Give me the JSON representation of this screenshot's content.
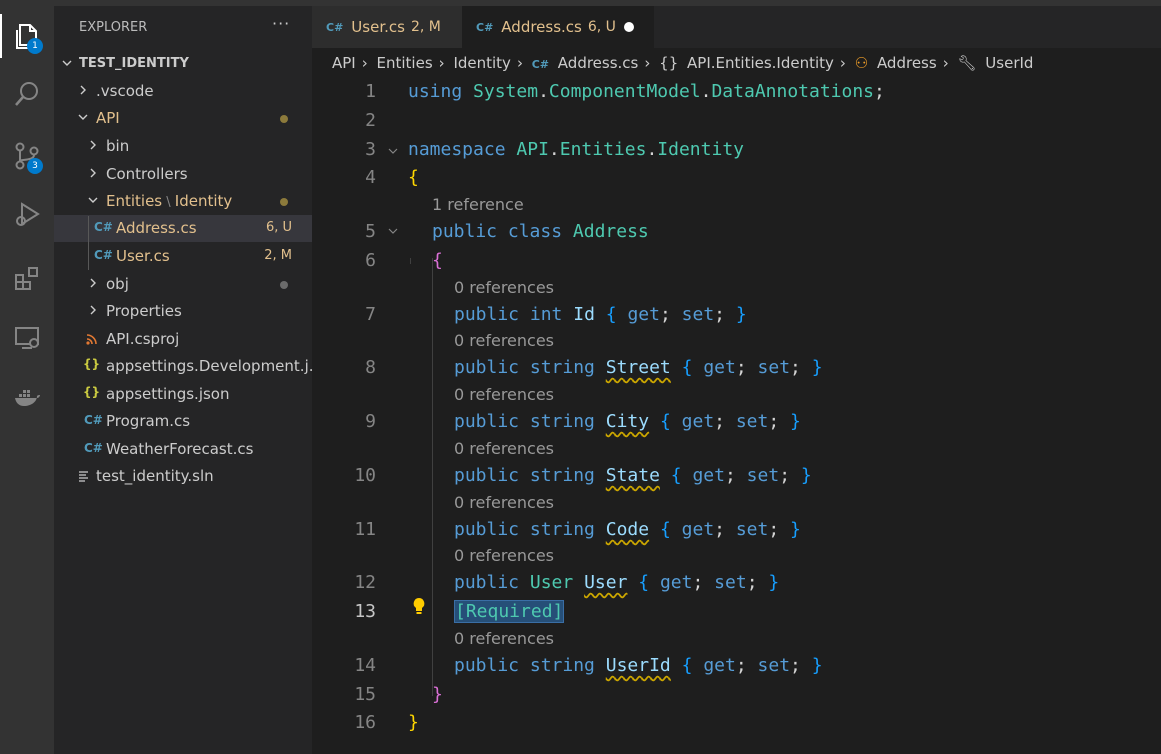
{
  "activity": {
    "explorer_badge": "1",
    "scm_badge": "3",
    "icons": [
      "files-icon",
      "search-icon",
      "source-control-icon",
      "run-debug-icon",
      "extensions-icon",
      "remote-explorer-icon",
      "docker-icon"
    ]
  },
  "sidebar": {
    "title": "EXPLORER",
    "more": "···",
    "root": "TEST_IDENTITY",
    "items": [
      {
        "label": ".vscode"
      },
      {
        "label": "API"
      },
      {
        "label": "bin"
      },
      {
        "label": "Controllers"
      },
      {
        "label": "Entities",
        "label2": "Identity"
      },
      {
        "label": "Address.cs",
        "status": "6, U"
      },
      {
        "label": "User.cs",
        "status": "2, M"
      },
      {
        "label": "obj"
      },
      {
        "label": "Properties"
      },
      {
        "label": "API.csproj"
      },
      {
        "label": "appsettings.Development.j..."
      },
      {
        "label": "appsettings.json"
      },
      {
        "label": "Program.cs"
      },
      {
        "label": "WeatherForecast.cs"
      },
      {
        "label": "test_identity.sln"
      }
    ]
  },
  "tabs": [
    {
      "label": "User.cs",
      "status": "2, M"
    },
    {
      "label": "Address.cs",
      "status": "6, U"
    }
  ],
  "breadcrumbs": [
    "API",
    "Entities",
    "Identity",
    "Address.cs",
    "API.Entities.Identity",
    "Address",
    "UserId"
  ],
  "editor": {
    "line_numbers": [
      "1",
      "2",
      "3",
      "4",
      "5",
      "6",
      "7",
      "8",
      "9",
      "10",
      "11",
      "12",
      "13",
      "14",
      "15",
      "16"
    ],
    "lens_1ref": "1 reference",
    "lens_0ref": "0 references",
    "t": {
      "using": "using",
      "ns_system": "System",
      "dot": ".",
      "ns_cm": "ComponentModel",
      "ns_da": "DataAnnotations",
      "semi": ";",
      "namespace": "namespace",
      "ns_api": "API",
      "ns_entities": "Entities",
      "ns_identity": "Identity",
      "lbrace": "{",
      "rbrace": "}",
      "public": "public",
      "class": "class",
      "class_name": "Address",
      "int": "int",
      "string": "string",
      "user_type": "User",
      "get": "get",
      "set": "set",
      "required": "[Required]",
      "props": [
        "Id",
        "Street",
        "City",
        "State",
        "Code",
        "User",
        "UserId"
      ]
    }
  }
}
